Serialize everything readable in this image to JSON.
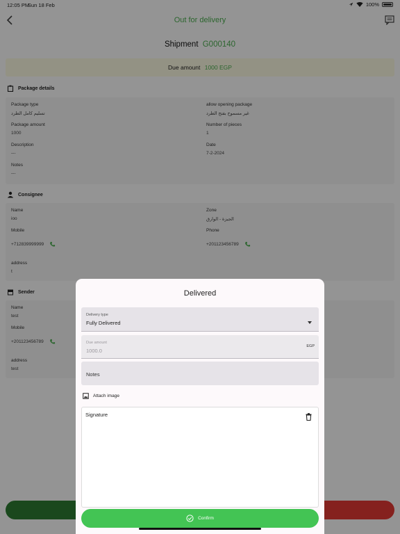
{
  "status_bar": {
    "time": "12:05 PM",
    "date": "Sun 18 Feb",
    "battery": "100%"
  },
  "nav": {
    "title": "Out for delivery"
  },
  "shipment": {
    "label": "Shipment",
    "number": "G000140"
  },
  "due": {
    "label": "Due amount",
    "value": "1000 EGP"
  },
  "package": {
    "heading": "Package details",
    "type_label": "Package type",
    "type_value": "تسليم كامل الطرد",
    "opening_label": "allow opening package",
    "opening_value": "غير مسموح بفتح الطرد",
    "amount_label": "Package amount",
    "amount_value": "1000",
    "pieces_label": "Number of pieces",
    "pieces_value": "1",
    "description_label": "Description",
    "description_value": "---",
    "date_label": "Date",
    "date_value": "7-2-2024",
    "notes_label": "Notes",
    "notes_value": "---"
  },
  "consignee": {
    "heading": "Consignee",
    "name_label": "Name",
    "name_value": "ioo",
    "zone_label": "Zone",
    "zone_value": "الجيزة - الوارق",
    "mobile_label": "Mobile",
    "mobile_value": "+712839999999",
    "phone_label": "Phone",
    "phone_value": "+201123456789",
    "address_label": "address",
    "address_value": "t"
  },
  "sender": {
    "heading": "Sender",
    "name_label": "Name",
    "name_value": "test",
    "mobile_label": "Mobile",
    "mobile_value": "+201123456789",
    "address_label": "address",
    "address_value": "test"
  },
  "modal": {
    "title": "Delivered",
    "delivery_type_label": "Delivery type",
    "delivery_type_value": "Fully Delivered",
    "due_amount_label": "Due amount",
    "due_amount_value": "1000.0",
    "due_amount_suffix": "EGP",
    "notes_placeholder": "Notes",
    "attach_label": "Attach image",
    "signature_label": "Signature",
    "confirm_label": "Confirm"
  },
  "colors": {
    "accent": "#4caf50",
    "confirm": "#43c454",
    "reject": "#e53935",
    "due_bg": "#fdfbe4"
  }
}
